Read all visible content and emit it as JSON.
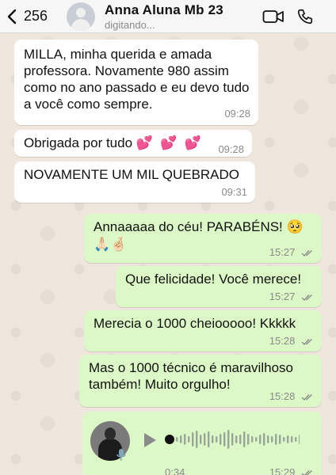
{
  "header": {
    "back_count": "256",
    "contact_name": "Anna Aluna Mb 23",
    "status": "digitando..."
  },
  "messages": [
    {
      "dir": "in",
      "text": "MILLA, minha querida e amada professora. Novamente 980 assim como no ano passado e eu devo tudo a você como sempre.",
      "time": "09:28"
    },
    {
      "dir": "in",
      "text": "Obrigada por tudo",
      "emoji": "💕 💕 💕",
      "time": "09:28"
    },
    {
      "dir": "in",
      "text": "NOVAMENTE UM MIL QUEBRADO",
      "time": "09:31"
    },
    {
      "dir": "out",
      "text": "Annaaaaa do céu! PARABÉNS!",
      "emoji": "🥺",
      "emoji2": "🙏🏻🤞🏻",
      "time": "15:27"
    },
    {
      "dir": "out",
      "text": "Que felicidade! Você merece!",
      "time": "15:27"
    },
    {
      "dir": "out",
      "text": "Merecia o 1000 cheiooooo! Kkkkk",
      "time": "15:28"
    },
    {
      "dir": "out",
      "text": "Mas o 1000 técnico é maravilhoso também! Muito orgulho!",
      "time": "15:28"
    }
  ],
  "audio": {
    "duration": "0:34",
    "time": "15:29",
    "progress": 0.0
  },
  "colors": {
    "outgoing_bubble": "#dcf8c6",
    "incoming_bubble": "#ffffff",
    "read_ticks": "#8a8a8a",
    "wallpaper": "#efe7de"
  }
}
